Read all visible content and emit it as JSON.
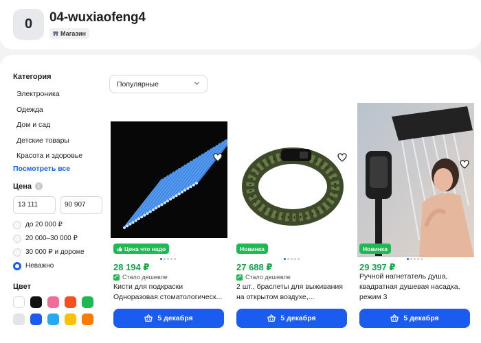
{
  "shop": {
    "avatar_letter": "0",
    "name": "04-wuxiaofeng4",
    "badge": "Магазин"
  },
  "sidebar": {
    "category_title": "Категория",
    "categories": [
      "Электроника",
      "Одежда",
      "Дом и сад",
      "Детские товары",
      "Красота и здоровье"
    ],
    "see_all": "Посмотреть все",
    "price_title": "Цена",
    "price_from": "13 111",
    "price_to": "90 907",
    "price_options": [
      "до 20 000 ₽",
      "20 000–30 000 ₽",
      "30 000 ₽ и дороже",
      "Неважно"
    ],
    "price_selected": "Неважно",
    "color_title": "Цвет",
    "colors": [
      "#ffffff",
      "#111111",
      "#f26b9a",
      "#f4511e",
      "#1db954",
      "#e3e4e7",
      "#1a5cf0",
      "#26a9f0",
      "#ffc107",
      "#ff7a00"
    ]
  },
  "sort": {
    "label": "Популярные"
  },
  "products": [
    {
      "tag": "Цена что надо",
      "price": "28 194 ₽",
      "cheaper": "Стало дешевле",
      "title_line1": "Кисти для подкраски",
      "title_line2": "Одноразовая стоматологическ...",
      "button": "5 декабря",
      "image": "blue-microbrushes"
    },
    {
      "tag": "Новинка",
      "price": "27 688 ₽",
      "cheaper": "Стало дешевле",
      "title_line1": "2 шт., браслеты для выживания",
      "title_line2": "на открытом воздухе,...",
      "button": "5 декабря",
      "image": "paracord-bracelet"
    },
    {
      "tag": "Новинка",
      "price": "29 397 ₽",
      "title_line1": "Ручной нагнетатель душа,",
      "title_line2": "квадратная душевая насадка,",
      "title_line3": "режим 3",
      "button": "5 декабря",
      "image": "shower-head"
    }
  ]
}
